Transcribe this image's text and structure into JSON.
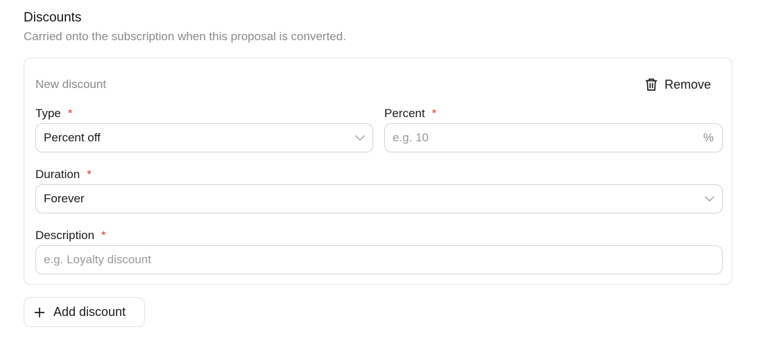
{
  "section": {
    "title": "Discounts",
    "subtitle": "Carried onto the subscription when this proposal is converted."
  },
  "card": {
    "title": "New discount",
    "remove_label": "Remove",
    "remove_icon": "trash-icon"
  },
  "fields": {
    "type": {
      "label": "Type",
      "required_marker": "*",
      "value": "Percent off",
      "icon": "chevron-down-icon"
    },
    "percent": {
      "label": "Percent",
      "required_marker": "*",
      "placeholder": "e.g. 10",
      "suffix": "%"
    },
    "duration": {
      "label": "Duration",
      "required_marker": "*",
      "value": "Forever",
      "icon": "chevron-down-icon"
    },
    "description": {
      "label": "Description",
      "required_marker": "*",
      "placeholder": "e.g. Loyalty discount"
    }
  },
  "add_button": {
    "label": "Add discount",
    "icon": "plus-icon"
  },
  "colors": {
    "required": "#e0382e",
    "muted_text": "#8a8a8a",
    "border": "#d4d4d4"
  }
}
